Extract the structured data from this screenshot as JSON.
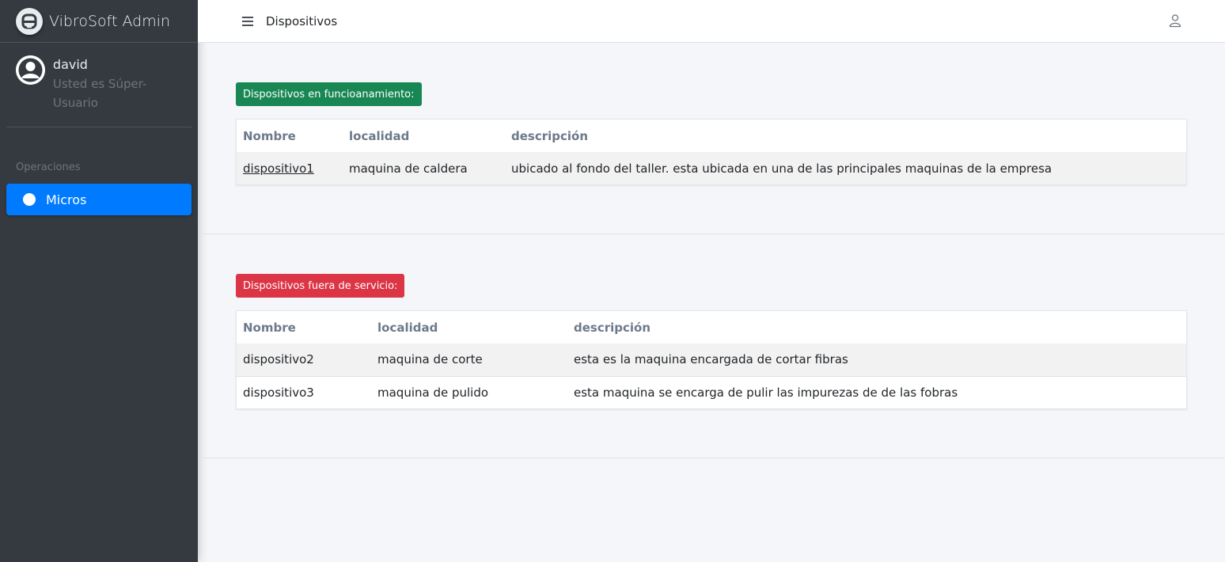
{
  "sidebar": {
    "brand": "VibroSoft Admin",
    "user": {
      "name": "david",
      "role": "Usted es Súper-Usuario"
    },
    "nav_header": "Operaciones",
    "items": [
      {
        "label": "Micros",
        "icon": "circle-icon",
        "active": true
      }
    ]
  },
  "topbar": {
    "title": "Dispositivos",
    "menu_icon": "hamburger-icon",
    "user_icon": "user-icon"
  },
  "active": {
    "badge": "Dispositivos en funcioanamiento:",
    "columns": [
      "Nombre",
      "localidad",
      "descripción"
    ],
    "rows": [
      {
        "nombre": "dispositivo1",
        "localidad": "maquina de caldera",
        "descripcion": "ubicado al fondo del taller. esta ubicada en una de las principales maquinas de la empresa"
      }
    ]
  },
  "inactive": {
    "badge": "Dispositivos fuera de servicio:",
    "columns": [
      "Nombre",
      "localidad",
      "descripción"
    ],
    "rows": [
      {
        "nombre": "dispositivo2",
        "localidad": "maquina de corte",
        "descripcion": "esta es la maquina encargada de cortar fibras"
      },
      {
        "nombre": "dispositivo3",
        "localidad": "maquina de pulido",
        "descripcion": "esta maquina se encarga de pulir las impurezas de de las fobras"
      }
    ]
  },
  "colors": {
    "sidebar": "#343a40",
    "accent": "#007bff",
    "success": "#198754",
    "danger": "#dc3545"
  }
}
